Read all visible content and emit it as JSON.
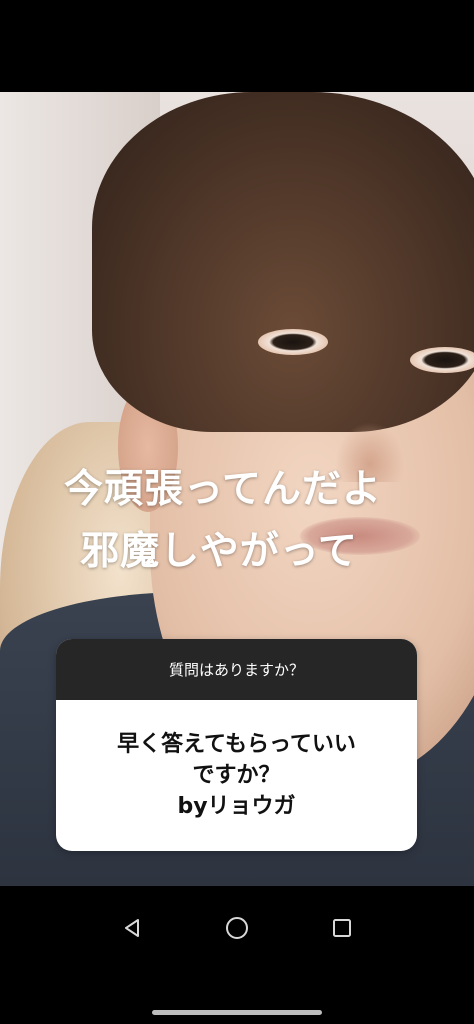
{
  "story": {
    "overlay_text": {
      "line1": "今頑張ってんだよ",
      "line2": "邪魔しやがって"
    },
    "question_sticker": {
      "header": "質問はありますか？",
      "answer_lines": [
        "早く答えてもらっていい",
        "ですか？",
        "byリョウガ"
      ]
    }
  },
  "navigation": {
    "back_icon": "triangle-back-icon",
    "home_icon": "circle-home-icon",
    "recents_icon": "square-recents-icon"
  }
}
